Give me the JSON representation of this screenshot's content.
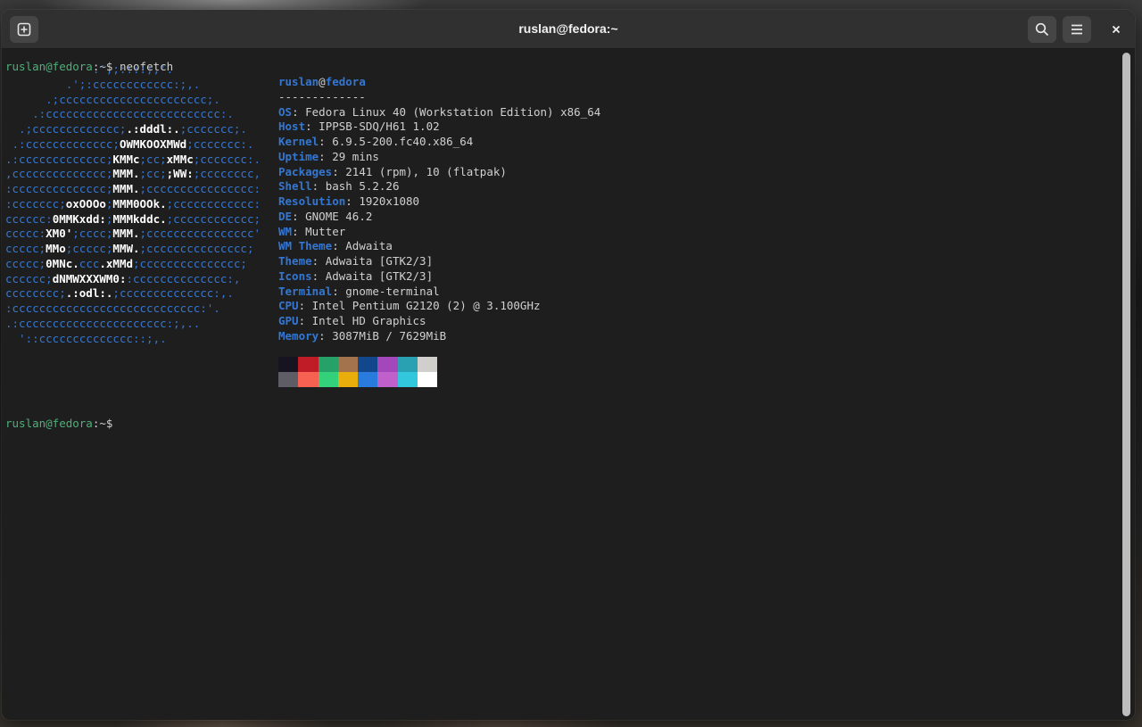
{
  "window": {
    "title": "ruslan@fedora:~"
  },
  "toolbar": {
    "new_tab_icon": "new-tab-plus-icon",
    "search_icon": "search-icon",
    "menu_icon": "hamburger-menu-icon",
    "close_icon": "close-icon"
  },
  "terminal": {
    "prompt_user_host": "ruslan@fedora",
    "prompt_path": ":~",
    "prompt_dollar": "$ ",
    "command": "neofetch",
    "final_prompt_user_host": "ruslan@fedora",
    "final_prompt_path": ":~",
    "final_prompt_dollar": "$"
  },
  "logo_lines": [
    [
      {
        "t": "             .',;::::;,'.",
        "s": "b"
      }
    ],
    [
      {
        "t": "         .';:cccccccccccc:;,.",
        "s": "b"
      }
    ],
    [
      {
        "t": "      .;cccccccccccccccccccccc;.",
        "s": "b"
      }
    ],
    [
      {
        "t": "    .:cccccccccccccccccccccccccc:.",
        "s": "b"
      }
    ],
    [
      {
        "t": "  .;ccccccccccccc;",
        "s": "b"
      },
      {
        "t": ".:dddl:.",
        "s": "w"
      },
      {
        "t": ";ccccccc;.",
        "s": "b"
      }
    ],
    [
      {
        "t": " .:ccccccccccccc;",
        "s": "b"
      },
      {
        "t": "OWMKOOXMWd",
        "s": "w"
      },
      {
        "t": ";ccccccc:.",
        "s": "b"
      }
    ],
    [
      {
        "t": ".:ccccccccccccc;",
        "s": "b"
      },
      {
        "t": "KMMc",
        "s": "w"
      },
      {
        "t": ";cc;",
        "s": "b"
      },
      {
        "t": "xMMc",
        "s": "w"
      },
      {
        "t": ";ccccccc:.",
        "s": "b"
      }
    ],
    [
      {
        "t": ",cccccccccccccc;",
        "s": "b"
      },
      {
        "t": "MMM.",
        "s": "w"
      },
      {
        "t": ";cc;",
        "s": "b"
      },
      {
        "t": ";WW:",
        "s": "w"
      },
      {
        "t": ";cccccccc,",
        "s": "b"
      }
    ],
    [
      {
        "t": ":cccccccccccccc;",
        "s": "b"
      },
      {
        "t": "MMM.",
        "s": "w"
      },
      {
        "t": ";cccccccccccccccc:",
        "s": "b"
      }
    ],
    [
      {
        "t": ":ccccccc;",
        "s": "b"
      },
      {
        "t": "oxOOOo",
        "s": "w"
      },
      {
        "t": ";",
        "s": "b"
      },
      {
        "t": "MMM0OOk.",
        "s": "w"
      },
      {
        "t": ";cccccccccccc:",
        "s": "b"
      }
    ],
    [
      {
        "t": "cccccc:",
        "s": "b"
      },
      {
        "t": "0MMKxdd:",
        "s": "w"
      },
      {
        "t": ";",
        "s": "b"
      },
      {
        "t": "MMMkddc.",
        "s": "w"
      },
      {
        "t": ";cccccccccccc;",
        "s": "b"
      }
    ],
    [
      {
        "t": "ccccc:",
        "s": "b"
      },
      {
        "t": "XM0'",
        "s": "w"
      },
      {
        "t": ";cccc;",
        "s": "b"
      },
      {
        "t": "MMM.",
        "s": "w"
      },
      {
        "t": ";cccccccccccccccc'",
        "s": "b"
      }
    ],
    [
      {
        "t": "ccccc;",
        "s": "b"
      },
      {
        "t": "MMo",
        "s": "w"
      },
      {
        "t": ";ccccc;",
        "s": "b"
      },
      {
        "t": "MMW.",
        "s": "w"
      },
      {
        "t": ";ccccccccccccccc;",
        "s": "b"
      }
    ],
    [
      {
        "t": "ccccc;",
        "s": "b"
      },
      {
        "t": "0MNc.",
        "s": "w"
      },
      {
        "t": "ccc",
        "s": "b"
      },
      {
        "t": ".xMMd",
        "s": "w"
      },
      {
        "t": ";ccccccccccccccc;",
        "s": "b"
      }
    ],
    [
      {
        "t": "cccccc;",
        "s": "b"
      },
      {
        "t": "dNMWXXXWM0:",
        "s": "w"
      },
      {
        "t": ":cccccccccccccc:,",
        "s": "b"
      }
    ],
    [
      {
        "t": "cccccccc;",
        "s": "b"
      },
      {
        "t": ".:odl:.",
        "s": "w"
      },
      {
        "t": ";cccccccccccccc:,.",
        "s": "b"
      }
    ],
    [
      {
        "t": ":cccccccccccccccccccccccccccc:'.",
        "s": "b"
      }
    ],
    [
      {
        "t": ".:cccccccccccccccccccccc:;,..",
        "s": "b"
      }
    ],
    [
      {
        "t": "  '::cccccccccccccc::;,.",
        "s": "b"
      }
    ]
  ],
  "info": {
    "user": "ruslan",
    "at": "@",
    "host": "fedora",
    "separator": "-------------",
    "rows": [
      {
        "key": "OS",
        "value": "Fedora Linux 40 (Workstation Edition) x86_64"
      },
      {
        "key": "Host",
        "value": "IPPSB-SDQ/H61 1.02"
      },
      {
        "key": "Kernel",
        "value": "6.9.5-200.fc40.x86_64"
      },
      {
        "key": "Uptime",
        "value": "29 mins"
      },
      {
        "key": "Packages",
        "value": "2141 (rpm), 10 (flatpak)"
      },
      {
        "key": "Shell",
        "value": "bash 5.2.26"
      },
      {
        "key": "Resolution",
        "value": "1920x1080"
      },
      {
        "key": "DE",
        "value": "GNOME 46.2"
      },
      {
        "key": "WM",
        "value": "Mutter"
      },
      {
        "key": "WM Theme",
        "value": "Adwaita"
      },
      {
        "key": "Theme",
        "value": "Adwaita [GTK2/3]"
      },
      {
        "key": "Icons",
        "value": "Adwaita [GTK2/3]"
      },
      {
        "key": "Terminal",
        "value": "gnome-terminal"
      },
      {
        "key": "CPU",
        "value": "Intel Pentium G2120 (2) @ 3.100GHz"
      },
      {
        "key": "GPU",
        "value": "Intel HD Graphics"
      },
      {
        "key": "Memory",
        "value": "3087MiB / 7629MiB"
      }
    ],
    "key_suffix": ": "
  },
  "palette": {
    "normal": [
      "#171421",
      "#c01c28",
      "#26a269",
      "#a2734c",
      "#12488b",
      "#a347ba",
      "#2aa1b3",
      "#d0cfcc"
    ],
    "bright": [
      "#5e5c64",
      "#f66151",
      "#33d17a",
      "#e9ad0c",
      "#2a7bde",
      "#c061cb",
      "#33c7de",
      "#ffffff"
    ]
  },
  "colors": {
    "prompt_green": "#4fb07a",
    "accent_blue": "#3477d2",
    "terminal_bg": "#1e1e1e",
    "headerbar_bg": "#303030"
  }
}
